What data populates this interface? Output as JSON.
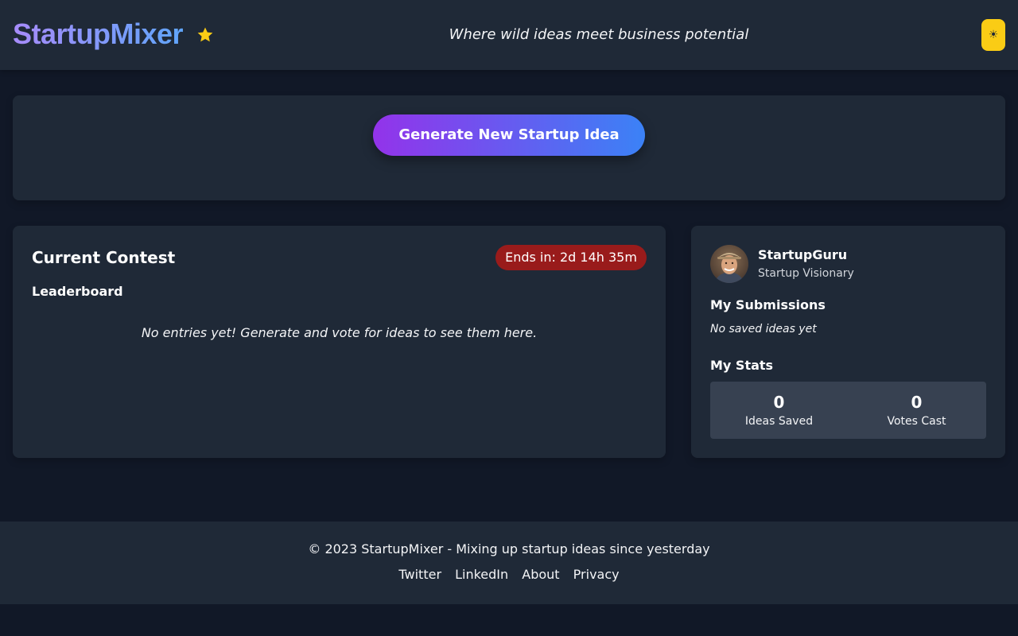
{
  "header": {
    "brand": "StartupMixer",
    "tagline": "Where wild ideas meet business potential",
    "theme_toggle_icon": "☀",
    "brand_gradient": [
      "#a78bfa",
      "#60a5fa"
    ],
    "star_color": "#facc15"
  },
  "generator": {
    "button_label": "Generate New Startup Idea",
    "button_gradient": [
      "#9333ea",
      "#3b82f6"
    ]
  },
  "contest": {
    "title": "Current Contest",
    "timer": "Ends in: 2d 14h 35m",
    "leaderboard_heading": "Leaderboard",
    "empty_message": "No entries yet! Generate and vote for ideas to see them here."
  },
  "profile": {
    "name": "StartupGuru",
    "title": "Startup Visionary",
    "submissions_heading": "My Submissions",
    "submissions_empty": "No saved ideas yet",
    "stats_heading": "My Stats",
    "stats": [
      {
        "value": "0",
        "label": "Ideas Saved"
      },
      {
        "value": "0",
        "label": "Votes Cast"
      }
    ]
  },
  "footer": {
    "copyright": "© 2023 StartupMixer - Mixing up startup ideas since yesterday",
    "links": [
      "Twitter",
      "LinkedIn",
      "About",
      "Privacy"
    ]
  },
  "icons": {
    "logo_star": "star-icon",
    "theme_toggle": "sun-icon",
    "avatar": "user-avatar"
  }
}
